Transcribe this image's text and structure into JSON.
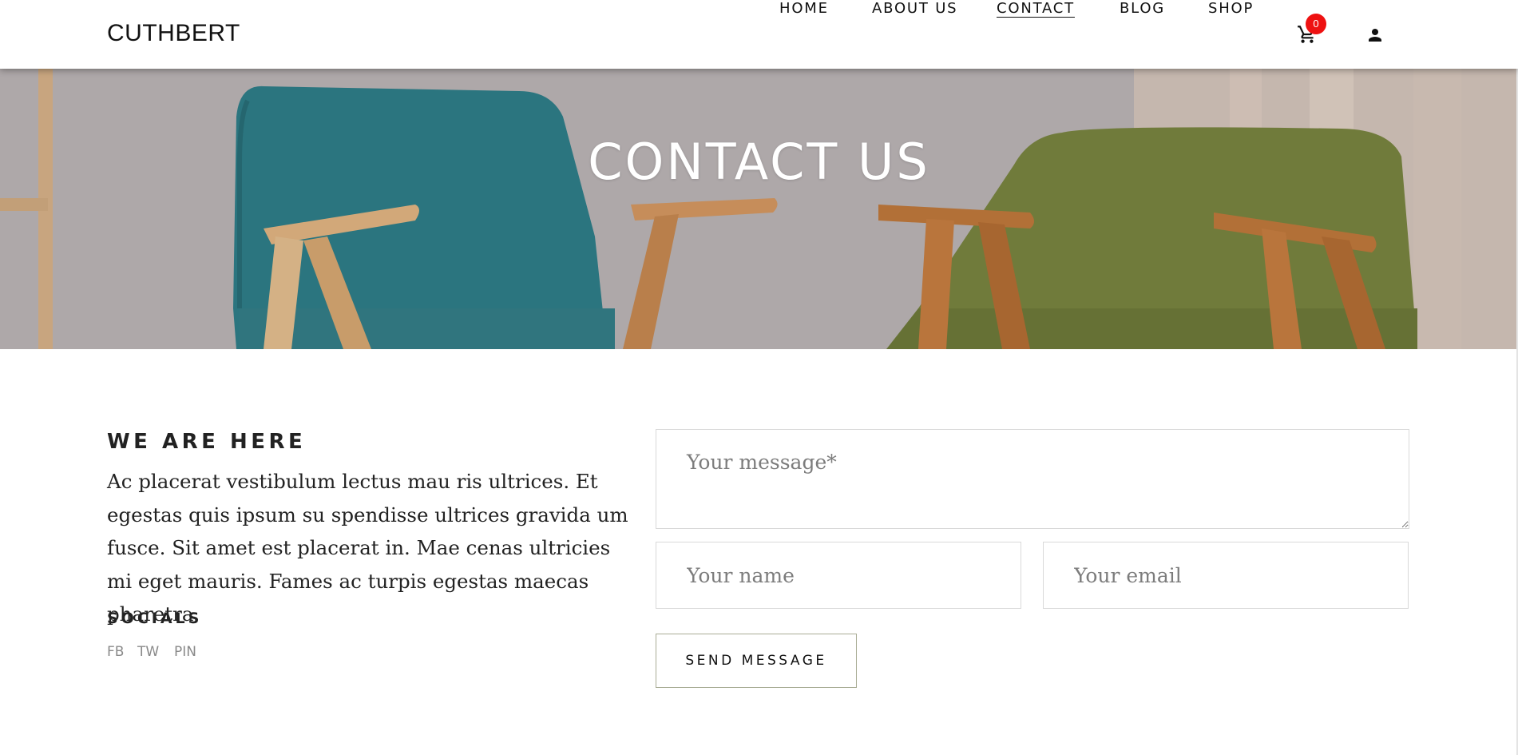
{
  "header": {
    "logo": "CUTHBERT",
    "nav": [
      {
        "label": "HOME",
        "active": false
      },
      {
        "label": "ABOUT US",
        "active": false
      },
      {
        "label": "CONTACT",
        "active": true
      },
      {
        "label": "BLOG",
        "active": false
      },
      {
        "label": "SHOP",
        "active": false
      }
    ],
    "cart_count": "0",
    "icons": [
      "cart-icon",
      "user-icon"
    ]
  },
  "hero": {
    "title": "CONTACT US"
  },
  "info": {
    "heading": "WE ARE HERE",
    "body": "Ac placerat vestibulum lectus mau ris ultrices. Et egestas quis ipsum su spendisse ultrices gravida um fusce. Sit amet est placerat in. Mae cenas ultricies mi eget mauris. Fames ac turpis egestas maecas pharetra.",
    "socials_title": "SOCIALS",
    "socials": [
      "FB",
      "TW",
      "PIN"
    ]
  },
  "form": {
    "message_placeholder": "Your message*",
    "name_placeholder": "Your name",
    "email_placeholder": "Your email",
    "submit_label": "SEND MESSAGE"
  },
  "colors": {
    "badge": "#ee1111",
    "button_border": "#a9ad96",
    "muted_text": "#8a8a8a"
  }
}
